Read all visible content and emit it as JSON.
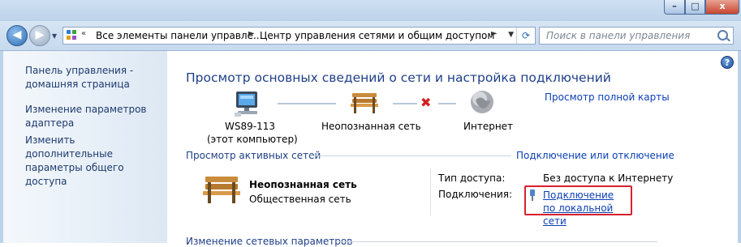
{
  "window": {
    "caption_buttons": {
      "minimize": "–",
      "maximize": "□",
      "close": "x"
    }
  },
  "nav": {
    "back_glyph": "◀",
    "forward_glyph": "▶",
    "history_glyph": "▼",
    "address": {
      "sep1": "«",
      "crumb1": "Все элементы панели управле...",
      "sep2": "►",
      "crumb2": "Центр управления сетями и общим доступом",
      "sep3": "►",
      "dropdown_glyph": "▼",
      "refresh_glyph": "⟳"
    },
    "search_placeholder": "Поиск в панели управления"
  },
  "sidebar": {
    "items": [
      {
        "label": "Панель управления - домашняя страница"
      },
      {
        "label": "Изменение параметров адаптера"
      },
      {
        "label": "Изменить дополнительные параметры общего доступа"
      }
    ]
  },
  "help_glyph": "?",
  "main": {
    "heading": "Просмотр основных сведений о сети и настройка подключений",
    "full_map_link": "Просмотр полной карты",
    "map": {
      "computer_name": "WS89-113",
      "computer_sub": "(этот компьютер)",
      "network_label": "Неопознанная сеть",
      "internet_label": "Интернет",
      "broken_link_glyph": "✖"
    },
    "active_networks_title": "Просмотр активных сетей",
    "connect_disconnect_link": "Подключение или отключение",
    "active_network": {
      "name": "Неопознанная сеть",
      "category": "Общественная сеть",
      "access_type_label": "Тип доступа:",
      "access_type_value": "Без доступа к Интернету",
      "connections_label": "Подключения:",
      "connection_link": "Подключение по локальной сети"
    },
    "change_settings_title": "Изменение сетевых параметров"
  },
  "colors": {
    "link": "#0b3fb5",
    "heading": "#1e3f86",
    "highlight_border": "#d8202e"
  }
}
